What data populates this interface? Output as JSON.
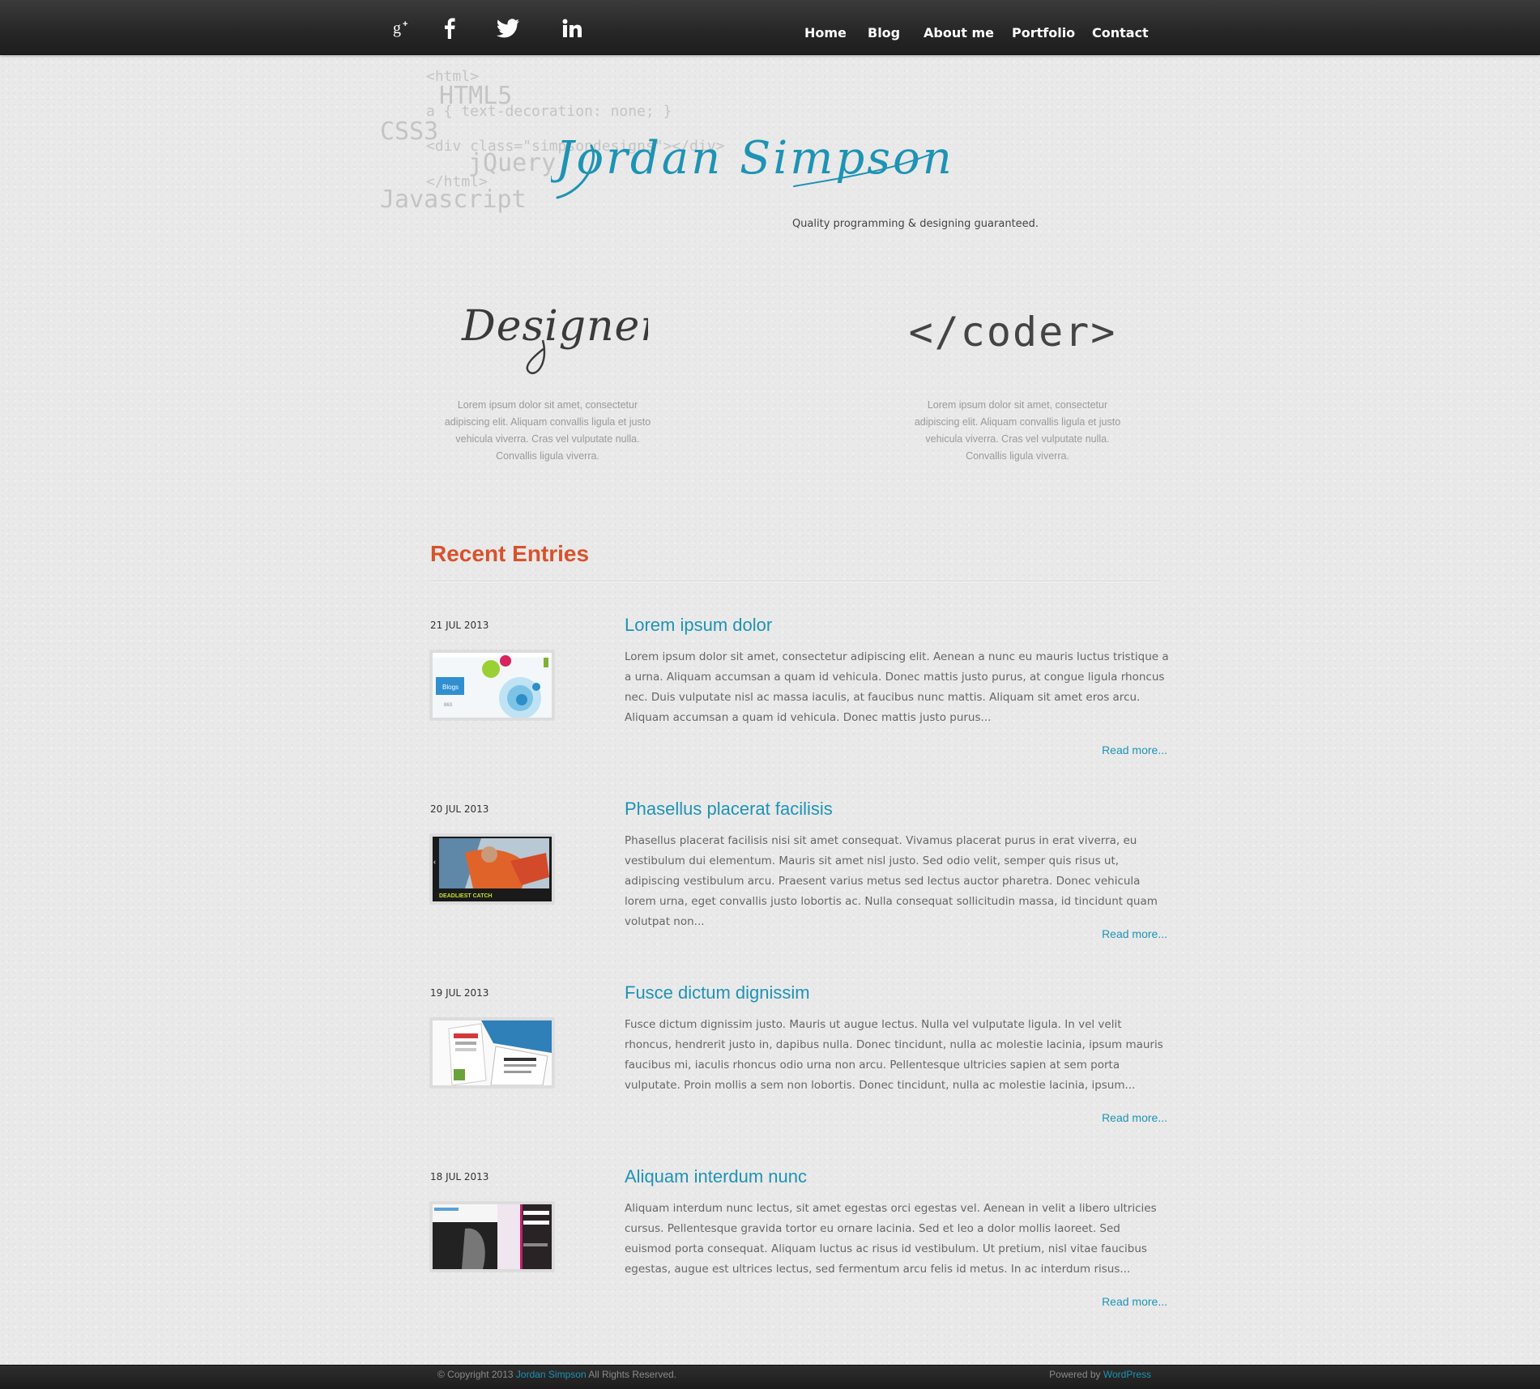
{
  "nav": {
    "social": [
      {
        "icon": "google-plus-icon"
      },
      {
        "icon": "facebook-icon"
      },
      {
        "icon": "twitter-icon"
      },
      {
        "icon": "linkedin-icon"
      }
    ],
    "links": [
      "Home",
      "Blog",
      "About me",
      "Portfolio",
      "Contact"
    ]
  },
  "header": {
    "code_lines": [
      "<html>",
      "HTML5",
      "a { text-decoration: none; }",
      "CSS3",
      "<div class=\"simpsondesigns\"></div>",
      "jQuery",
      "</html>",
      "Javascript"
    ],
    "name": "Jordan Simpson",
    "tagline": "Quality programming & designing guaranteed."
  },
  "features": {
    "designer": {
      "heading": "Designer",
      "text": "Lorem ipsum dolor sit amet, consectetur adipiscing elit. Aliquam convallis ligula et justo vehicula viverra. Cras vel vulputate nulla. Convallis ligula viverra."
    },
    "coder": {
      "heading": "</coder>",
      "text": "Lorem ipsum dolor sit amet, consectetur adipiscing elit. Aliquam convallis ligula et justo vehicula viverra. Cras vel vulputate nulla. Convallis ligula viverra."
    }
  },
  "recent": {
    "title": "Recent Entries",
    "entries": [
      {
        "date": "21 JUL 2013",
        "title": "Lorem ipsum dolor",
        "excerpt": "Lorem ipsum dolor sit amet, consectetur adipiscing elit. Aenean a nunc eu mauris luctus tristique a a urna. Aliquam accumsan a quam id vehicula. Donec mattis justo purus, at congue ligula rhoncus nec. Duis vulputate nisl ac massa iaculis, at faucibus nunc mattis. Aliquam sit amet eros arcu. Aliquam accumsan a quam id vehicula. Donec mattis justo purus...",
        "read_more": "Read more..."
      },
      {
        "date": "20 JUL 2013",
        "title": "Phasellus placerat facilisis",
        "excerpt": "Phasellus placerat facilisis nisi sit amet consequat. Vivamus placerat purus in erat viverra, eu vestibulum dui elementum. Mauris sit amet nisl justo. Sed odio velit, semper quis risus ut, adipiscing vestibulum arcu. Praesent varius metus sed lectus auctor pharetra. Donec vehicula lorem urna, eget convallis justo lobortis ac. Nulla consequat sollicitudin massa, id tincidunt quam volutpat non...",
        "read_more": "Read more..."
      },
      {
        "date": "19 JUL 2013",
        "title": "Fusce dictum dignissim",
        "excerpt": "Fusce dictum dignissim justo. Mauris ut augue lectus. Nulla vel vulputate ligula. In vel velit rhoncus, hendrerit justo in, dapibus nulla. Donec tincidunt, nulla ac molestie lacinia, ipsum mauris faucibus mi, iaculis rhoncus odio urna non arcu. Pellentesque ultricies sapien at sem porta vulputate. Proin mollis a sem non lobortis. Donec tincidunt, nulla ac molestie lacinia, ipsum...",
        "read_more": "Read more..."
      },
      {
        "date": "18 JUL 2013",
        "title": "Aliquam interdum nunc",
        "excerpt": "Aliquam interdum nunc lectus, sit amet egestas orci egestas vel. Aenean in velit a libero ultricies cursus. Pellentesque gravida tortor eu ornare lacinia. Sed et leo a dolor mollis laoreet. Sed euismod porta consequat. Aliquam luctus ac risus id vestibulum. Ut pretium, nisl vitae faucibus egestas, augue est ultrices lectus, sed fermentum arcu felis id metus. In ac interdum risus...",
        "read_more": "Read more..."
      }
    ],
    "thumbs": {
      "t1_label": "Blogs",
      "t1_count": "863",
      "t2_caption": "DEADLIEST CATCH"
    }
  },
  "footer": {
    "copy_prefix": "© Copyright 2013 ",
    "copy_name": "Jordan Simpson",
    "copy_suffix": " All Rights Reserved.",
    "powered_prefix": "Powered by ",
    "powered_name": "WordPress"
  },
  "colors": {
    "accent": "#1e93b4",
    "section_title": "#d8522c",
    "topbar": "#262626"
  }
}
